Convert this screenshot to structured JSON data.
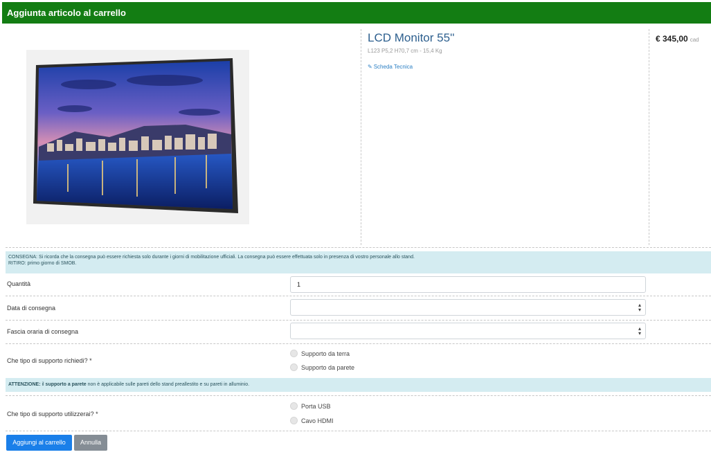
{
  "dialog": {
    "title": "Aggiunta articolo al carrello"
  },
  "product": {
    "title": "LCD Monitor 55''",
    "dimensions": "L123 P5,2 H70,7 cm - 15,4 Kg",
    "tech_sheet_link": "Scheda Tecnica",
    "price": "€ 345,00",
    "price_unit": "cad"
  },
  "notice": {
    "line1": "CONSEGNA: Si ricorda che la consegna può essere richiesta solo durante i giorni di mobilitazione ufficiali. La consegna può essere effettuata solo in presenza di vostro personale allo stand.",
    "line2": "RITIRO: primo giorno di SMOB."
  },
  "form": {
    "quantity_label": "Quantità",
    "quantity_value": "1",
    "delivery_date_label": "Data di consegna",
    "delivery_date_value": "",
    "time_slot_label": "Fascia oraria di consegna",
    "time_slot_value": "",
    "support_type_label": "Che tipo di supporto richiedi? *",
    "support_options": [
      "Supporto da terra",
      "Supporto da parete"
    ],
    "connection_label": "Che tipo di supporto utilizzerai? *",
    "connection_options": [
      "Porta USB",
      "Cavo HDMI"
    ]
  },
  "warning": {
    "prefix": "ATTENZIONE:",
    "text1": " il ",
    "bold": "supporto a parete",
    "text2": " non è applicabile sulle pareti dello stand preallestito e su pareti in alluminio."
  },
  "buttons": {
    "add_to_cart": "Aggiungi al carrello",
    "cancel": "Annulla"
  },
  "icons": {
    "select_caret": "up-down-caret-icon",
    "link": "pencil-icon"
  },
  "colors": {
    "header": "#137d13",
    "primary": "#1a7fe9",
    "secondary": "#858d95",
    "info_bg": "#d4ecf1"
  }
}
